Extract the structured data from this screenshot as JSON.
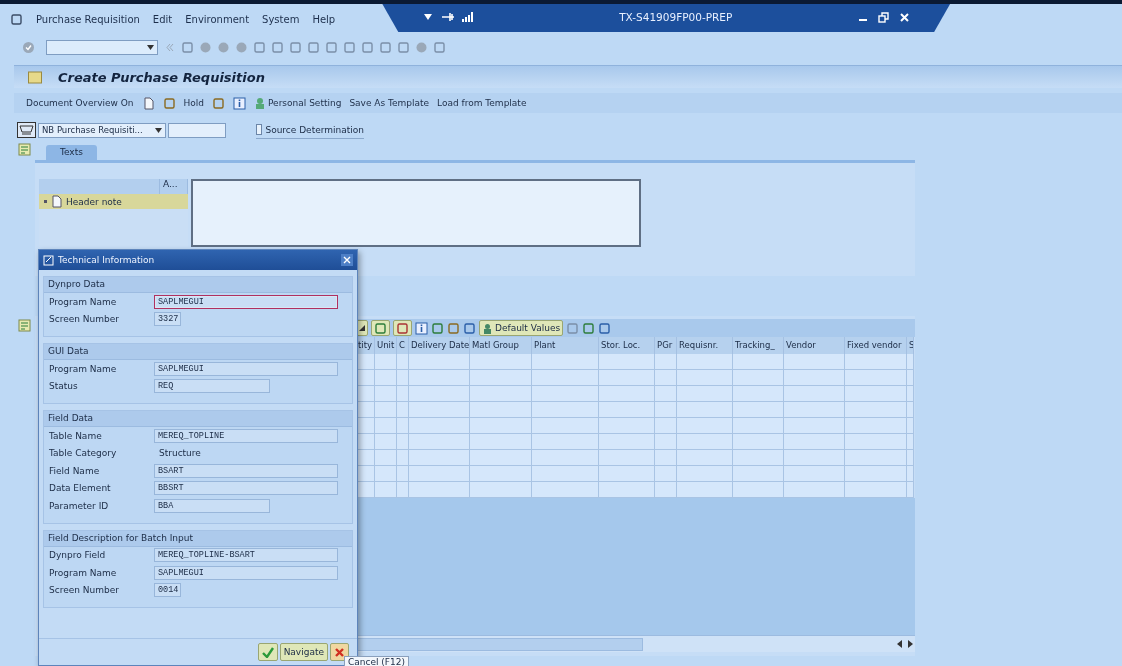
{
  "menu_bar": {
    "items": [
      "Purchase Requisition",
      "Edit",
      "Environment",
      "System",
      "Help"
    ]
  },
  "title_bar": {
    "title": "TX-S41909FP00-PREP"
  },
  "screen_title": "Create Purchase Requisition",
  "app_toolbar": [
    {
      "kind": "text",
      "label": "Document Overview On"
    },
    {
      "kind": "icon"
    },
    {
      "kind": "icon"
    },
    {
      "kind": "text",
      "label": "Hold"
    },
    {
      "kind": "icon"
    },
    {
      "kind": "icon"
    },
    {
      "kind": "iconText",
      "label": "Personal Setting"
    },
    {
      "kind": "text",
      "label": "Save As Template"
    },
    {
      "kind": "text",
      "label": "Load from Template"
    }
  ],
  "header": {
    "doc_type": "NB Purchase Requisiti...",
    "source_determination": {
      "label": "Source Determination",
      "checked": false
    }
  },
  "tabs": [
    {
      "label": "Texts",
      "selected": true
    }
  ],
  "texts_panel": {
    "column_2": "A...",
    "items": [
      {
        "label": "Header note",
        "selected": true
      }
    ]
  },
  "items_toolbar": {
    "default_values": "Default Values"
  },
  "table": {
    "columns": [
      "tity",
      "Unit",
      "C",
      "Delivery Date",
      "Matl Group",
      "Plant",
      "Stor. Loc.",
      "PGr",
      "Requisnr.",
      "Tracking_",
      "Vendor",
      "Fixed vendor",
      "S"
    ]
  },
  "dialog": {
    "title": "Technical Information",
    "sections": [
      {
        "title": "Dynpro Data",
        "rows": [
          {
            "label": "Program Name",
            "value": "SAPLMEGUI",
            "kind": "wide",
            "focused": true
          },
          {
            "label": "Screen Number",
            "value": "3327",
            "kind": "narrow",
            "focused": false
          }
        ]
      },
      {
        "title": "GUI Data",
        "rows": [
          {
            "label": "Program Name",
            "value": "SAPLMEGUI",
            "kind": "wide",
            "focused": false
          },
          {
            "label": "Status",
            "value": "REQ",
            "kind": "medium",
            "focused": false
          }
        ]
      },
      {
        "title": "Field Data",
        "rows": [
          {
            "label": "Table Name",
            "value": "MEREQ_TOPLINE",
            "kind": "wide",
            "focused": false
          },
          {
            "label": "Table Category",
            "value": "Structure",
            "kind": "plain",
            "focused": false
          },
          {
            "label": "Field Name",
            "value": "BSART",
            "kind": "wide",
            "focused": false
          },
          {
            "label": "Data Element",
            "value": "BBSRT",
            "kind": "wide",
            "focused": false
          },
          {
            "label": "Parameter ID",
            "value": "BBA",
            "kind": "medium",
            "focused": false
          }
        ]
      },
      {
        "title": "Field Description for Batch Input",
        "rows": [
          {
            "label": "Dynpro Field",
            "value": "MEREQ_TOPLINE-BSART",
            "kind": "wide",
            "focused": false
          },
          {
            "label": "Program Name",
            "value": "SAPLMEGUI",
            "kind": "wide",
            "focused": false
          },
          {
            "label": "Screen Number",
            "value": "0014",
            "kind": "narrow",
            "focused": false
          }
        ]
      }
    ],
    "navigate": "Navigate"
  },
  "tooltip": "Cancel   (F12)"
}
